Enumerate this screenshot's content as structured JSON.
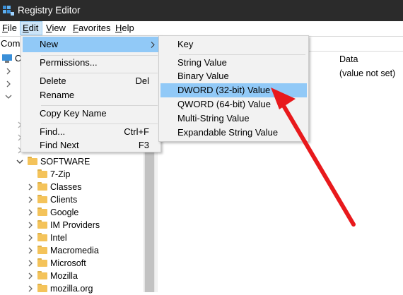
{
  "window": {
    "title": "Registry Editor"
  },
  "menubar": [
    {
      "label": "File",
      "key": "F",
      "rest": "ile"
    },
    {
      "label": "Edit",
      "key": "E",
      "rest": "dit"
    },
    {
      "label": "View",
      "key": "V",
      "rest": "iew"
    },
    {
      "label": "Favorites",
      "key": "F",
      "rest": "avorites"
    },
    {
      "label": "Help",
      "key": "H",
      "rest": "elp"
    }
  ],
  "address": {
    "text": "Com"
  },
  "list": {
    "col_data": "Data",
    "row_data": "(value not set)"
  },
  "tree": {
    "partial_label": "C",
    "software": "SOFTWARE",
    "children": [
      "7-Zip",
      "Classes",
      "Clients",
      "Google",
      "IM Providers",
      "Intel",
      "Macromedia",
      "Microsoft",
      "Mozilla",
      "mozilla.org"
    ]
  },
  "edit_menu": {
    "new": "New",
    "permissions": "Permissions...",
    "delete": "Delete",
    "delete_sc": "Del",
    "rename": "Rename",
    "copy_key_name": "Copy Key Name",
    "find": "Find...",
    "find_sc": "Ctrl+F",
    "find_next": "Find Next",
    "find_next_sc": "F3"
  },
  "new_submenu": {
    "key": "Key",
    "string": "String Value",
    "binary": "Binary Value",
    "dword": "DWORD (32-bit) Value",
    "qword": "QWORD (64-bit) Value",
    "multi": "Multi-String Value",
    "expandable": "Expandable String Value"
  },
  "colors": {
    "highlight": "#91c9f7",
    "menu_bg": "#f2f2f2",
    "titlebar": "#2b2b2b",
    "arrow": "#e8191c",
    "folder": "#f4c35a"
  }
}
